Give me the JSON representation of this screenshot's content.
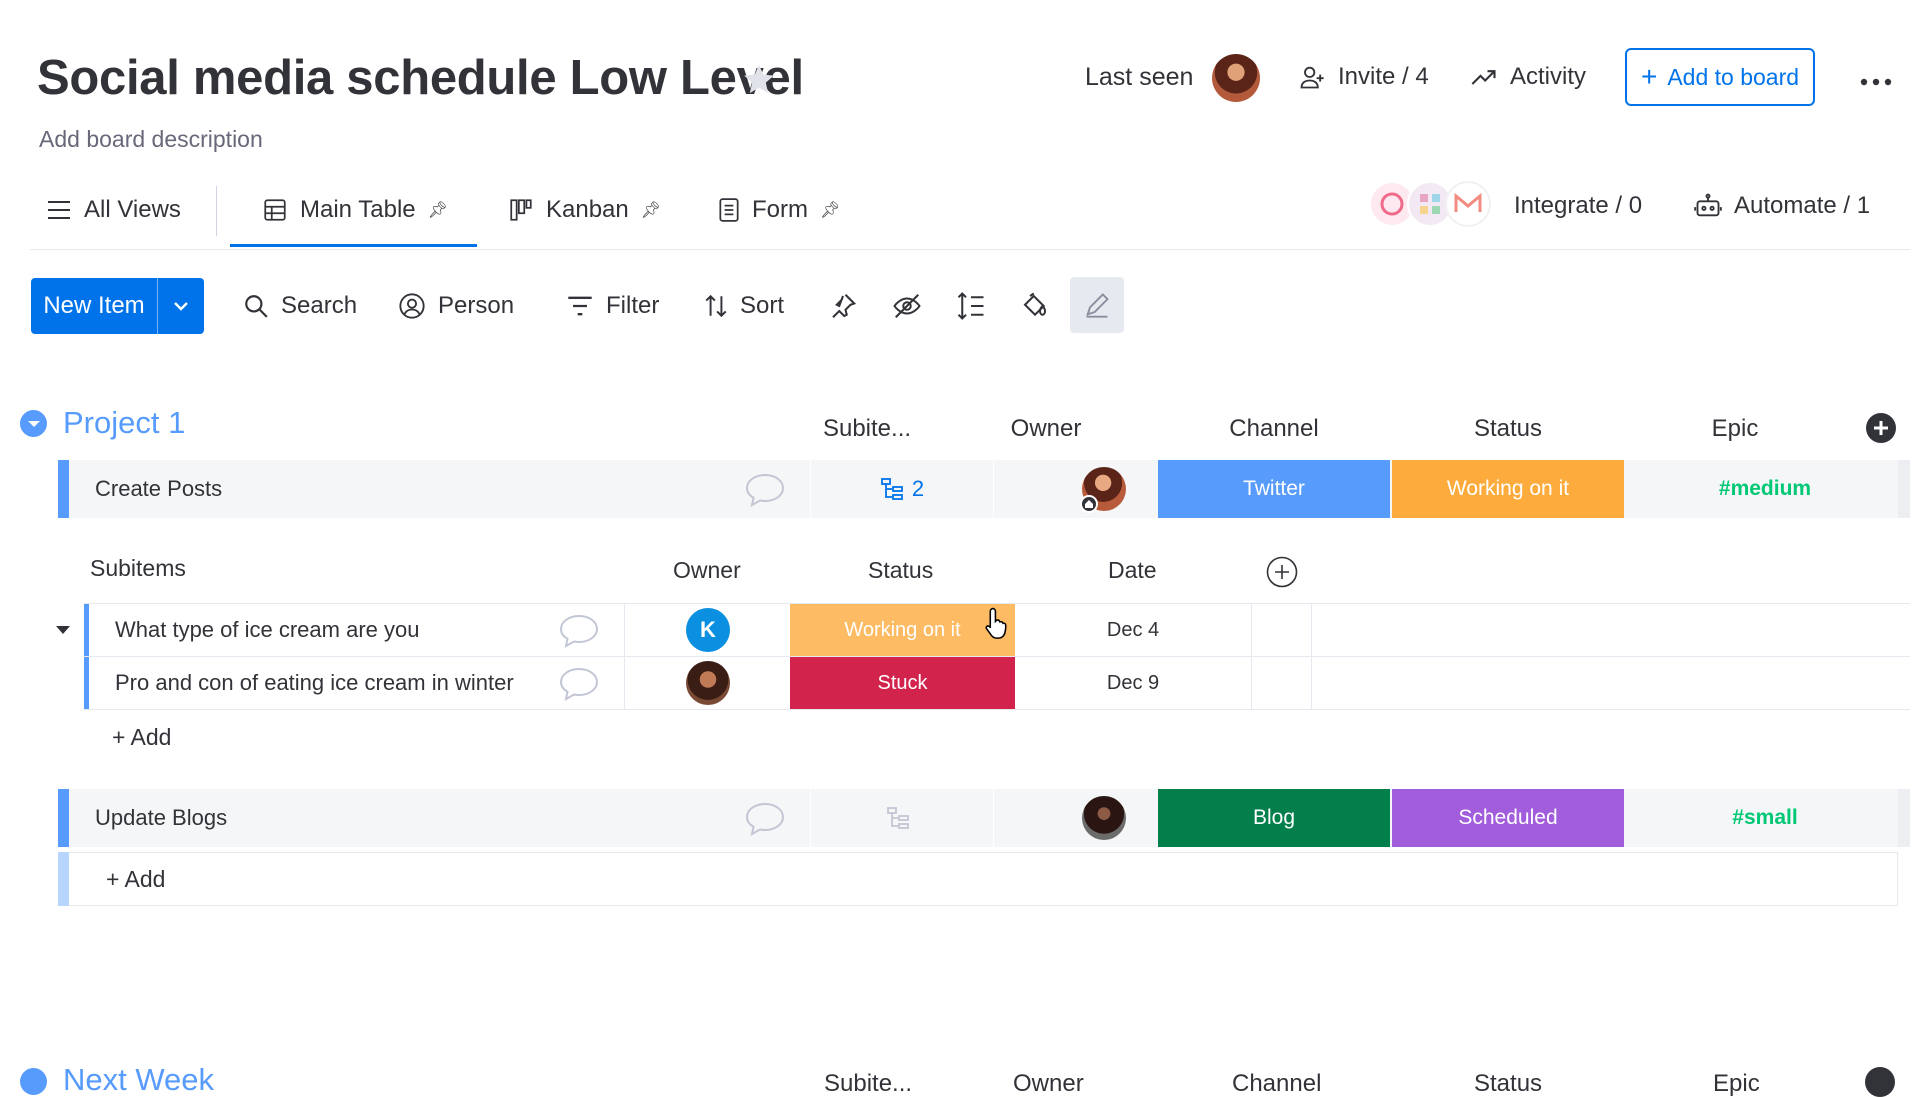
{
  "header": {
    "title": "Social media schedule Low Level",
    "description": "Add board description",
    "last_seen": "Last seen",
    "invite": "Invite / 4",
    "activity": "Activity",
    "add_to_board": "Add to board"
  },
  "views": {
    "all": "All Views",
    "main": "Main Table",
    "kanban": "Kanban",
    "form": "Form",
    "integrate": "Integrate / 0",
    "automate": "Automate / 1"
  },
  "toolbar": {
    "new_item": "New Item",
    "search": "Search",
    "person": "Person",
    "filter": "Filter",
    "sort": "Sort"
  },
  "group": {
    "title": "Project 1",
    "columns": {
      "subitems": "Subite...",
      "owner": "Owner",
      "channel": "Channel",
      "status": "Status",
      "epic": "Epic"
    },
    "rows": [
      {
        "name": "Create Posts",
        "subitems_count": "2",
        "channel": "Twitter",
        "channel_color": "#579bfc",
        "status": "Working on it",
        "status_color": "#fdab3d",
        "epic": "#medium"
      },
      {
        "name": "Update Blogs",
        "subitems_count": "",
        "channel": "Blog",
        "channel_color": "#037f4c",
        "status": "Scheduled",
        "status_color": "#a25ddc",
        "epic": "#small"
      }
    ],
    "add_item": "+ Add"
  },
  "subitems": {
    "header": "Subitems",
    "columns": {
      "owner": "Owner",
      "status": "Status",
      "date": "Date"
    },
    "rows": [
      {
        "name": "What type of ice cream are you",
        "owner_initial": "K",
        "status": "Working on it",
        "status_color": "#fdbc64",
        "date": "Dec 4"
      },
      {
        "name": "Pro and con of eating ice cream in winter",
        "status": "Stuck",
        "status_color": "#d2234d",
        "date": "Dec 9"
      }
    ],
    "add": "+ Add"
  },
  "next_group": {
    "title": "Next Week",
    "columns": [
      "Subite...",
      "Owner",
      "Channel",
      "Status",
      "Epic"
    ]
  },
  "colors": {
    "primary": "#0073ea",
    "group": "#579bfc",
    "epic": "#00c875"
  }
}
